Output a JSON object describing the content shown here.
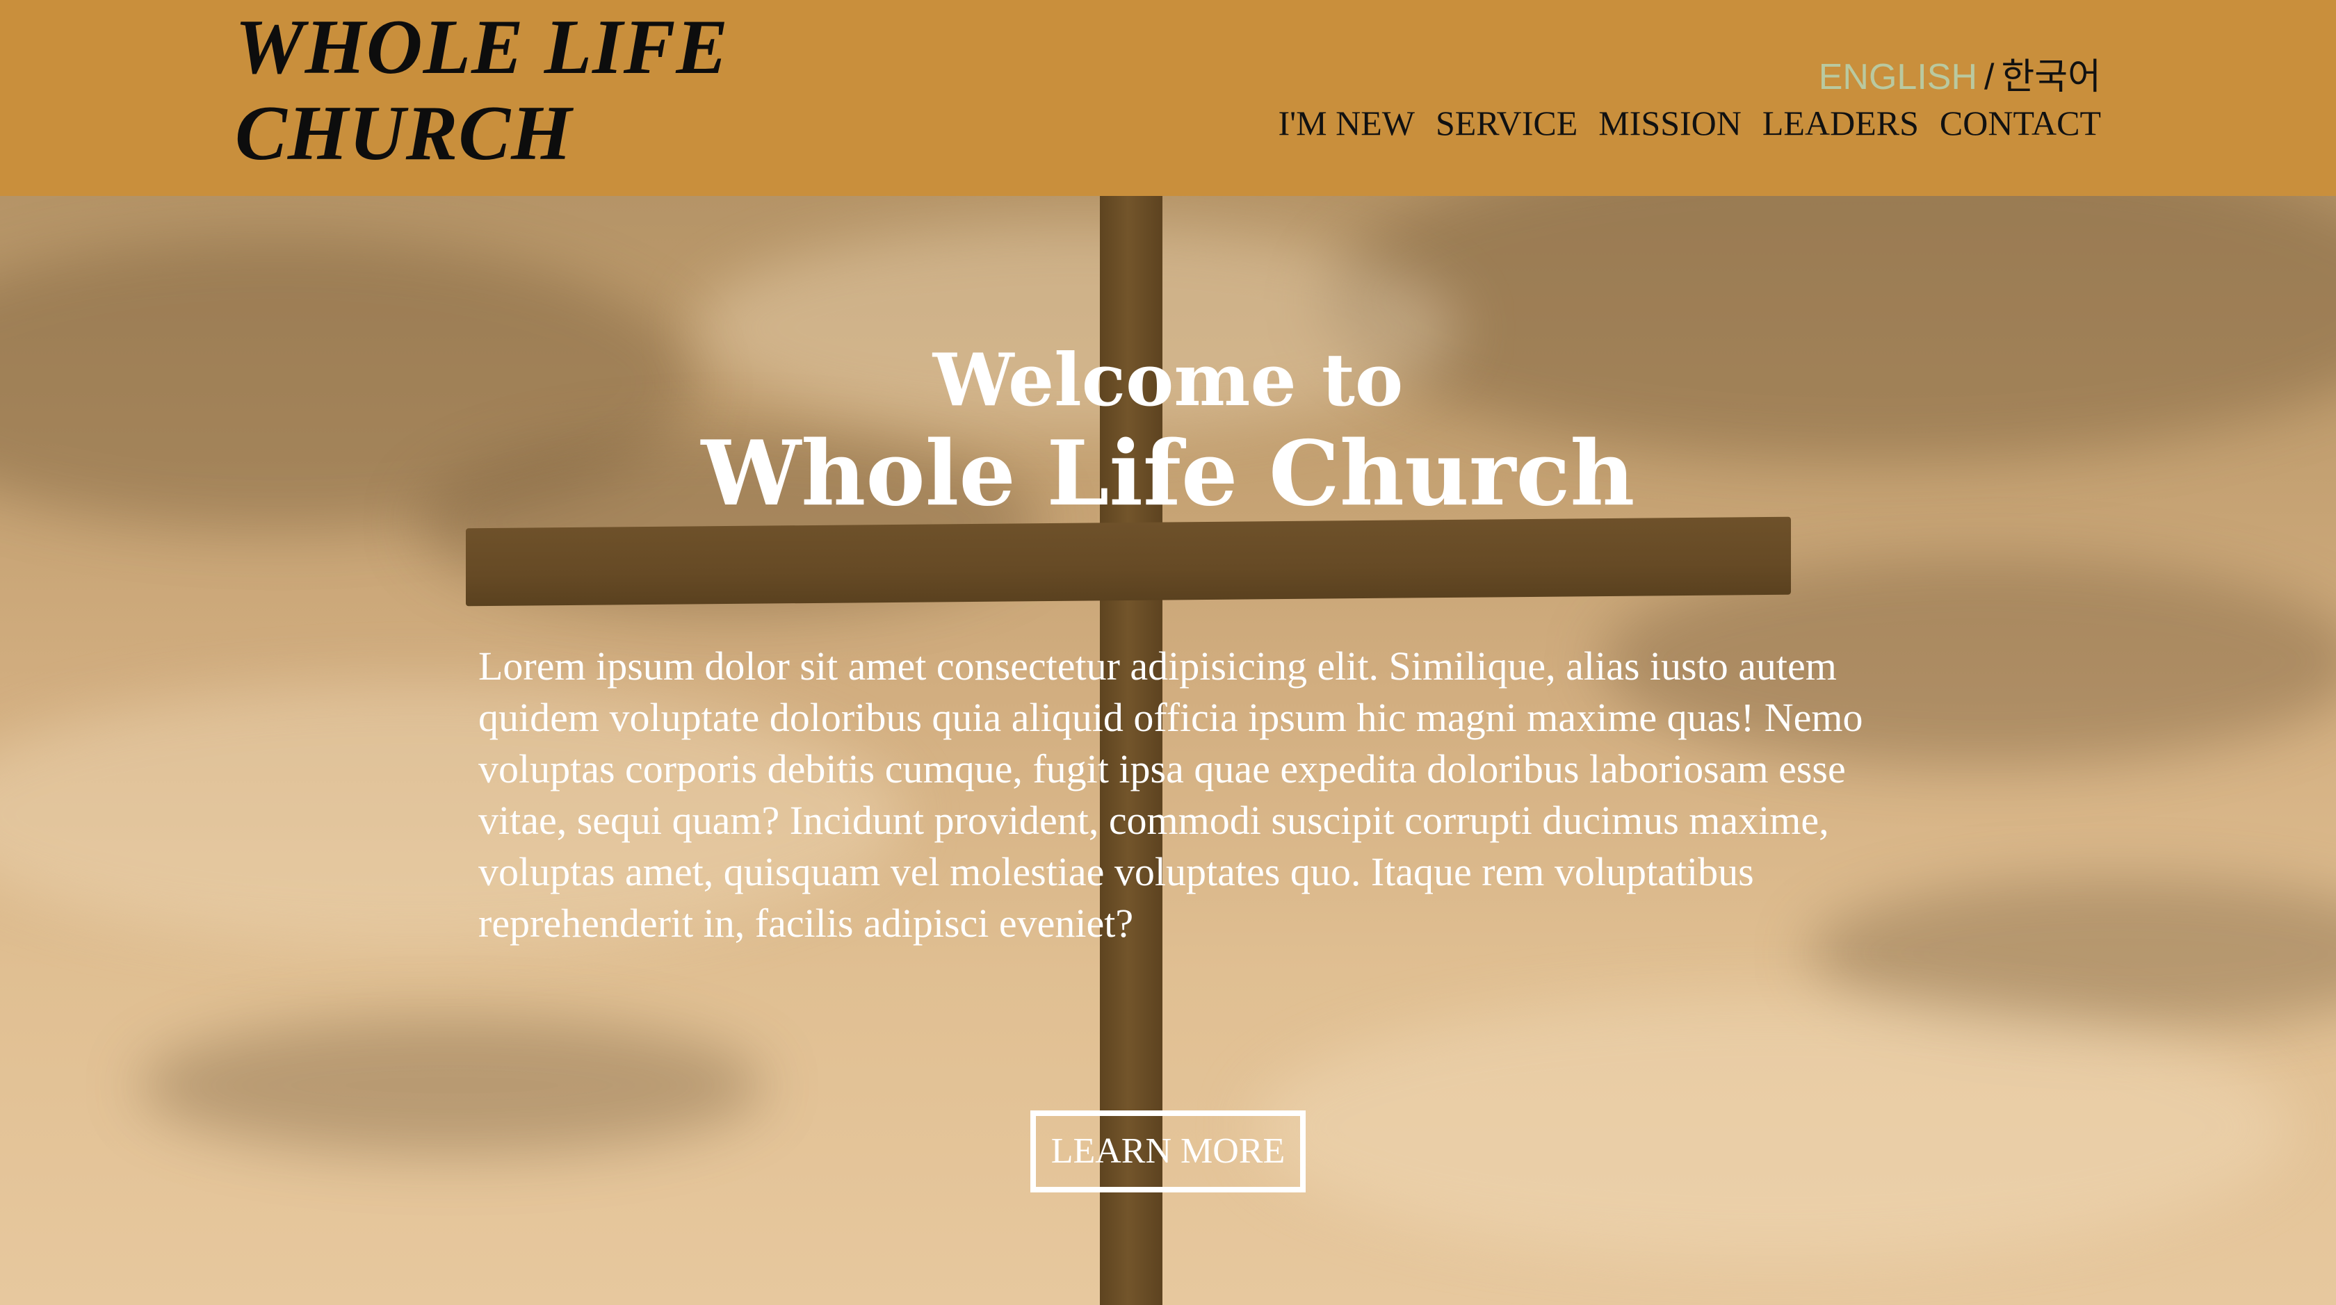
{
  "header": {
    "logo_line1": "WHOLE LIFE",
    "logo_line2": "CHURCH",
    "language": {
      "english": "ENGLISH",
      "separator": "/",
      "korean": "한국어"
    },
    "nav": [
      "I'M NEW",
      "SERVICE",
      "MISSION",
      "LEADERS",
      "CONTACT"
    ]
  },
  "hero": {
    "welcome_line1": "Welcome to",
    "welcome_line2": "Whole Life Church",
    "body": "Lorem ipsum dolor sit amet consectetur adipisicing elit. Similique, alias iusto autem quidem voluptate doloribus quia aliquid officia ipsum hic magni maxime quas! Nemo voluptas corporis debitis cumque, fugit ipsa quae expedita doloribus laboriosam esse vitae, sequi quam? Incidunt provident, commodi suscipit corrupti ducimus maxime, voluptas amet, quisquam vel molestiae voluptates quo. Itaque rem voluptatibus reprehenderit in, facilis adipisci eveniet?",
    "button_label": "LEARN MORE"
  },
  "colors": {
    "header_bg": "#c98f3c",
    "english_active": "#b9c9a0",
    "text_dark": "#111111",
    "text_light": "#ffffff"
  }
}
